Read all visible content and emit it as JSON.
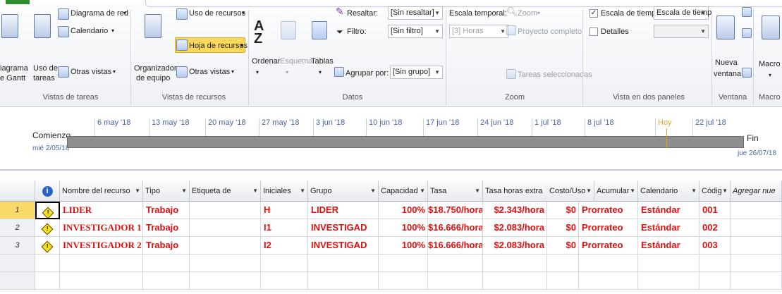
{
  "ribbon": {
    "task_views": {
      "gantt_line1": "iagrama",
      "gantt_line2": "e Gantt",
      "resource_usage_line1": "Uso de",
      "resource_usage_line2": "tareas",
      "network_diagram": "Diagrama de red",
      "calendar": "Calendario",
      "other_views": "Otras vistas",
      "group_label": "Vistas de tareas"
    },
    "resource_views": {
      "team_planner_line1": "Organizador",
      "team_planner_line2": "de equipo",
      "resource_usage": "Uso de recursos",
      "resource_sheet": "Hoja de recursos",
      "other_views": "Otras vistas",
      "group_label": "Vistas de recursos"
    },
    "data": {
      "sort": "Ordenar",
      "outline": "Esquema",
      "tables": "Tablas",
      "highlight_label": "Resaltar:",
      "highlight_value": "[Sin resaltar]",
      "filter_label": "Filtro:",
      "filter_value": "[Sin filtro]",
      "group_by_label": "Agrupar por:",
      "group_by_value": "[Sin grupo]",
      "group_label": "Datos"
    },
    "zoom": {
      "timescale_label": "Escala temporal:",
      "timescale_value": "[3] Horas",
      "zoom": "Zoom",
      "entire_project": "Proyecto completo",
      "selected_tasks": "Tareas seleccionadas",
      "group_label": "Zoom"
    },
    "split_view": {
      "timeline_label": "Escala de tiempo",
      "timeline_value": "Escala de tiemp",
      "details_label": "Detalles",
      "group_label": "Vista en dos paneles"
    },
    "window": {
      "new_window_line1": "Nueva",
      "new_window_line2": "ventana",
      "group_label": "Ventana"
    },
    "macros": {
      "label": "Macro",
      "group_label": "Macro"
    }
  },
  "timeline": {
    "dates": [
      "6 may '18",
      "13 may '18",
      "20 may '18",
      "27 may '18",
      "3 jun '18",
      "10 jun '18",
      "17 jun '18",
      "24 jun '18",
      "1 jul '18",
      "8 jul '18",
      "Hoy",
      "22 jul '18"
    ],
    "start_label": "Comienzo",
    "start_date": "mié 2/05/18",
    "end_label": "Fin",
    "end_date": "jue 26/07/18",
    "today_color": "#f0a020"
  },
  "table": {
    "info_icon": "i",
    "headers": {
      "name": "Nombre del recurso",
      "type": "Tipo",
      "label": "Etiqueta de",
      "initials": "Iniciales",
      "group": "Grupo",
      "capacity": "Capacidad",
      "rate": "Tasa",
      "overtime": "Tasa horas extra",
      "cost_use": "Costo/Uso",
      "accrue": "Acumular",
      "calendar": "Calendario",
      "code": "Códig",
      "add_new": "Agregar nue"
    },
    "rows": [
      {
        "num": "1",
        "name": "LIDER",
        "type": "Trabajo",
        "label": "",
        "initials": "H",
        "group": "LIDER",
        "capacity": "100%",
        "rate": "$18.750/hora",
        "overtime": "$2.343/hora",
        "cost_use": "$0",
        "accrue": "Prorrateo",
        "calendar": "Estándar",
        "code": "001"
      },
      {
        "num": "2",
        "name": "INVESTIGADOR 1",
        "type": "Trabajo",
        "label": "",
        "initials": "I1",
        "group": "INVESTIGAD",
        "capacity": "100%",
        "rate": "$16.666/hora",
        "overtime": "$2.083/hora",
        "cost_use": "$0",
        "accrue": "Prorrateo",
        "calendar": "Estándar",
        "code": "002"
      },
      {
        "num": "3",
        "name": "INVESTIGADOR 2",
        "type": "Trabajo",
        "label": "",
        "initials": "I2",
        "group": "INVESTIGAD",
        "capacity": "100%",
        "rate": "$16.666/hora",
        "overtime": "$2.083/hora",
        "cost_use": "$0",
        "accrue": "Prorrateo",
        "calendar": "Estándar",
        "code": "003"
      }
    ],
    "text_color": "#e01010"
  }
}
